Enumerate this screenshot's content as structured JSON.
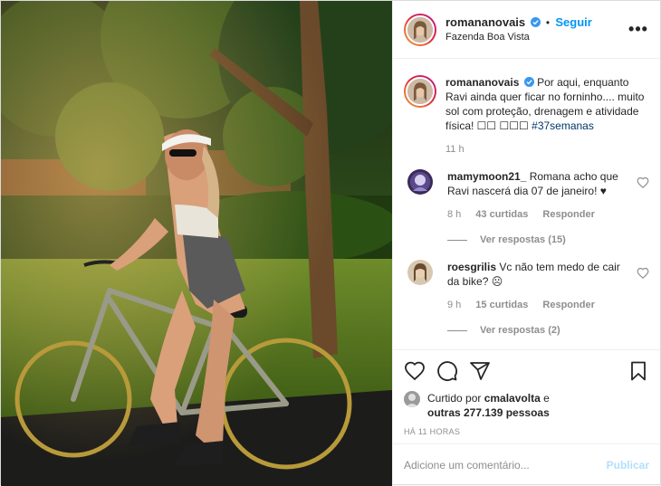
{
  "post": {
    "username": "romananovais",
    "follow_label": "Seguir",
    "location": "Fazenda Boa Vista",
    "more_label": "•••"
  },
  "caption": {
    "username": "romananovais",
    "text": "Por aqui, enquanto Ravi ainda quer ficar no forninho.... muito sol com proteção, drenagem e atividade física! ☐☐ ☐☐☐ ",
    "hashtag": "#37semanas",
    "time": "11 h"
  },
  "comments": [
    {
      "username": "mamymoon21_",
      "text": "Romana acho que Ravi nascerá dia 07 de janeiro! ♥",
      "time": "8 h",
      "likes": "43 curtidas",
      "reply_label": "Responder",
      "view_replies": "Ver respostas (15)"
    },
    {
      "username": "roesgrilis",
      "text": "Vc não tem medo de cair da bike? ☹",
      "time": "9 h",
      "likes": "15 curtidas",
      "reply_label": "Responder",
      "view_replies": "Ver respostas (2)"
    }
  ],
  "likes": {
    "prefix": "Curtido por ",
    "user": "cmalavolta",
    "middle": " e",
    "others": "outras 277.139 pessoas"
  },
  "timestamp": "HÁ 11 HORAS",
  "add_comment": {
    "placeholder": "Adicione um comentário...",
    "publish_label": "Publicar"
  },
  "icons": {
    "more": "more-icon",
    "verified": "verified-icon",
    "like": "heart-icon",
    "comment": "comment-icon",
    "share": "share-icon",
    "save": "bookmark-icon"
  },
  "colors": {
    "follow": "#0095f6",
    "hashtag": "#00376b",
    "muted": "#8e8e8e",
    "publish_disabled": "#b2dffc",
    "verified": "#3897f0"
  }
}
